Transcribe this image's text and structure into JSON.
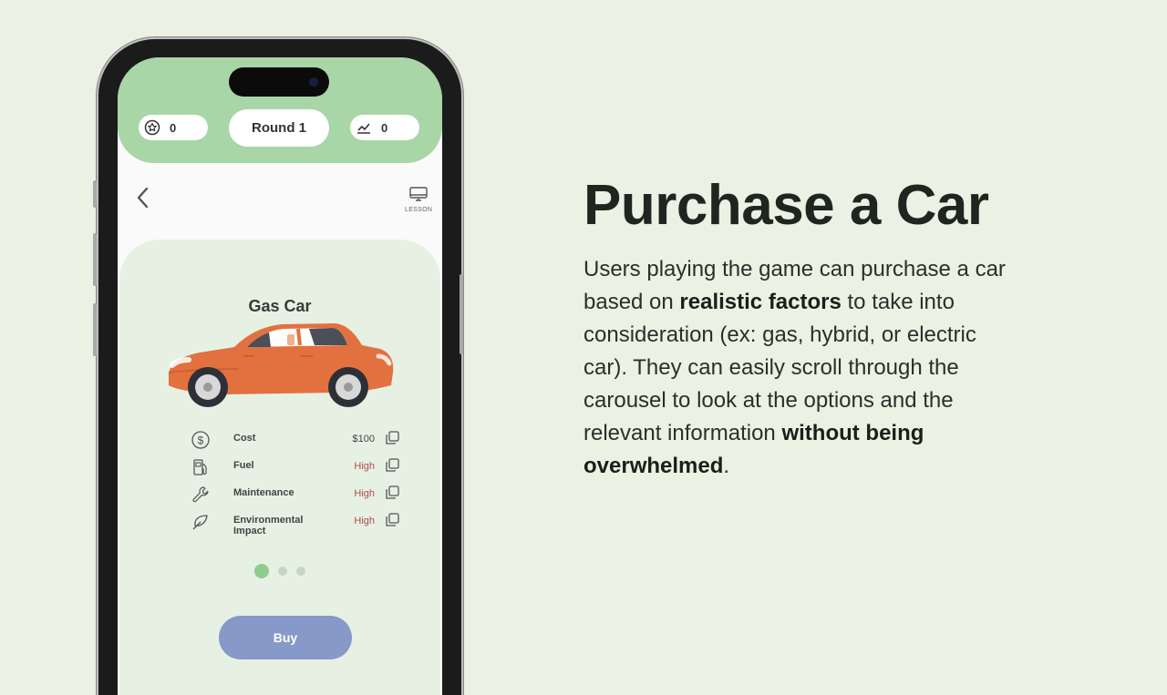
{
  "phone": {
    "stats": {
      "stars": "0",
      "round": "Round 1",
      "growth": "0"
    },
    "lesson_label": "LESSON",
    "car": {
      "title": "Gas Car",
      "specs": [
        {
          "name": "Cost",
          "value": "$100",
          "icon": "dollar-icon"
        },
        {
          "name": "Fuel",
          "value": "High",
          "icon": "fuel-pump-icon"
        },
        {
          "name": "Maintenance",
          "value": "High",
          "icon": "wrench-icon"
        },
        {
          "name": "Environmental Impact",
          "value": "High",
          "icon": "leaf-icon"
        }
      ]
    },
    "carousel": {
      "count": 3,
      "active": 1
    },
    "buy_label": "Buy"
  },
  "heading": "Purchase a Car",
  "description": {
    "part1": "Users playing the game can purchase a car based on ",
    "bold1": "realistic factors",
    "part2": " to take into consideration (ex: gas, hybrid, or electric car). They can easily scroll through the carousel to look at the options and the relevant information ",
    "bold2": "without being overwhelmed",
    "part3": "."
  },
  "colors": {
    "background": "#ebf2e4",
    "topbar": "#a8d6a7",
    "card": "#e6f1e4",
    "car": "#e2713f",
    "buy_button": "#8799c8",
    "active_dot": "#8fcc8f",
    "high_value": "#b04a4a"
  }
}
